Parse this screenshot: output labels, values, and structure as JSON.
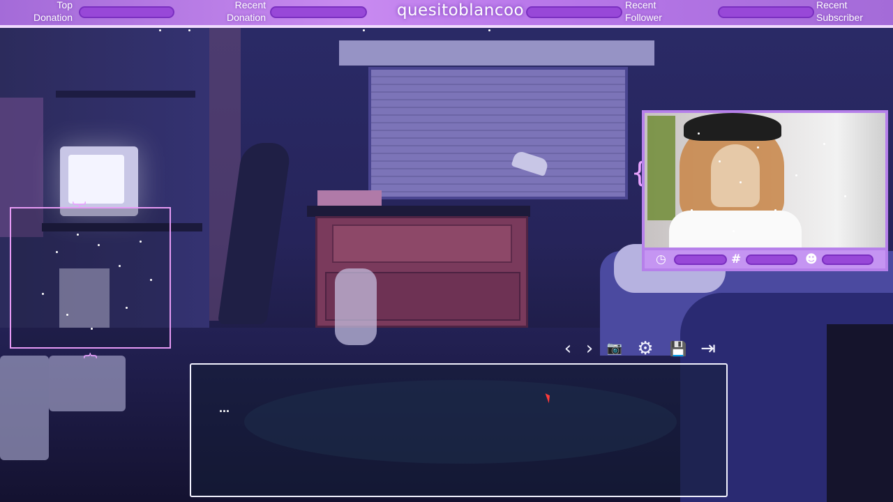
{
  "topbar": {
    "top_donation_label": "Top\nDonation",
    "recent_donation_label": "Recent\nDonation",
    "channel_name": "quesitoblancoo",
    "recent_follower_label": "Recent\nFollower",
    "recent_subscriber_label": "Recent\nSubscriber"
  },
  "overlay_colors": {
    "accent": "#b978ea",
    "pill": "#9848d8",
    "frame": "#e79af5"
  },
  "webcam_bar": {
    "icons": [
      "clock-icon",
      "hashtag-icon",
      "user-icon"
    ],
    "hashtag_symbol": "#"
  },
  "game_toolbar": {
    "back": "‹",
    "forward": "›",
    "screenshot": "📷",
    "settings": "⚙",
    "save": "💾",
    "exit": "⇥",
    "icons": [
      "chevron-left-icon",
      "chevron-right-icon",
      "camera-icon",
      "gear-icon",
      "save-icon",
      "exit-icon"
    ]
  },
  "dialogue": {
    "text": "..."
  }
}
